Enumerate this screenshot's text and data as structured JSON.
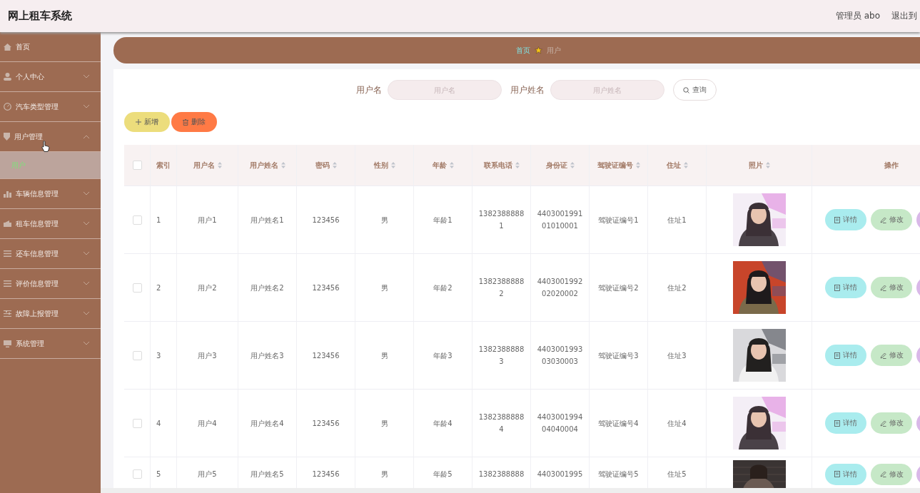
{
  "header": {
    "title": "网上租车系统",
    "user": "管理员 abo",
    "logout": "退出到"
  },
  "sidebar": {
    "items": [
      {
        "label": "首页",
        "kind": "link"
      },
      {
        "label": "个人中心",
        "kind": "menu",
        "expanded": false
      },
      {
        "label": "汽车类型管理",
        "kind": "menu",
        "expanded": false
      },
      {
        "label": "用户管理",
        "kind": "menu",
        "expanded": true,
        "children": [
          {
            "label": "用户",
            "selected": true
          }
        ]
      },
      {
        "label": "车辆信息管理",
        "kind": "menu",
        "expanded": false
      },
      {
        "label": "租车信息管理",
        "kind": "menu",
        "expanded": false
      },
      {
        "label": "还车信息管理",
        "kind": "menu",
        "expanded": false
      },
      {
        "label": "评价信息管理",
        "kind": "menu",
        "expanded": false
      },
      {
        "label": "故障上报管理",
        "kind": "menu",
        "expanded": false
      },
      {
        "label": "系统管理",
        "kind": "menu",
        "expanded": false
      }
    ]
  },
  "breadcrumb": [
    "首页",
    "用户"
  ],
  "search": {
    "fields": [
      {
        "label": "用户名",
        "placeholder": "用户名"
      },
      {
        "label": "用户姓名",
        "placeholder": "用户姓名"
      }
    ],
    "button": "查询"
  },
  "actions": [
    {
      "label": "新增",
      "kind": "add"
    },
    {
      "label": "删除",
      "kind": "delete"
    }
  ],
  "table": {
    "select_all": false,
    "columns": [
      {
        "label": "索引",
        "sortable": false
      },
      {
        "label": "用户名",
        "sortable": true
      },
      {
        "label": "用户姓名",
        "sortable": true
      },
      {
        "label": "密码",
        "sortable": true
      },
      {
        "label": "性别",
        "sortable": true
      },
      {
        "label": "年龄",
        "sortable": true
      },
      {
        "label": "联系电话",
        "sortable": true
      },
      {
        "label": "身份证",
        "sortable": true
      },
      {
        "label": "驾驶证编号",
        "sortable": true
      },
      {
        "label": "住址",
        "sortable": true
      },
      {
        "label": "照片",
        "sortable": true
      },
      {
        "label": "操作",
        "sortable": false
      }
    ],
    "rows": [
      {
        "checked": false,
        "cells": [
          "1",
          "用户1",
          "用户姓名1",
          "123456",
          "男",
          "年龄1",
          "13823888881",
          "440300199101010001",
          "驾驶证编号1",
          "住址1"
        ],
        "buttons": [
          "详情",
          "修改"
        ]
      },
      {
        "checked": false,
        "cells": [
          "2",
          "用户2",
          "用户姓名2",
          "123456",
          "男",
          "年龄2",
          "13823888882",
          "440300199202020002",
          "驾驶证编号2",
          "住址2"
        ],
        "buttons": [
          "详情",
          "修改"
        ]
      },
      {
        "checked": false,
        "cells": [
          "3",
          "用户3",
          "用户姓名3",
          "123456",
          "男",
          "年龄3",
          "13823888883",
          "440300199303030003",
          "驾驶证编号3",
          "住址3"
        ],
        "buttons": [
          "详情",
          "修改"
        ]
      },
      {
        "checked": false,
        "cells": [
          "4",
          "用户4",
          "用户姓名4",
          "123456",
          "男",
          "年龄4",
          "13823888884",
          "440300199404040004",
          "驾驶证编号4",
          "住址4"
        ],
        "buttons": [
          "详情",
          "修改"
        ]
      },
      {
        "checked": false,
        "cells": [
          "5",
          "用户5",
          "用户姓名5",
          "123456",
          "男",
          "年龄5",
          "1382388888",
          "4403001995",
          "驾驶证编号5",
          "住址5"
        ],
        "buttons": [
          "详情",
          "修改"
        ]
      }
    ]
  }
}
